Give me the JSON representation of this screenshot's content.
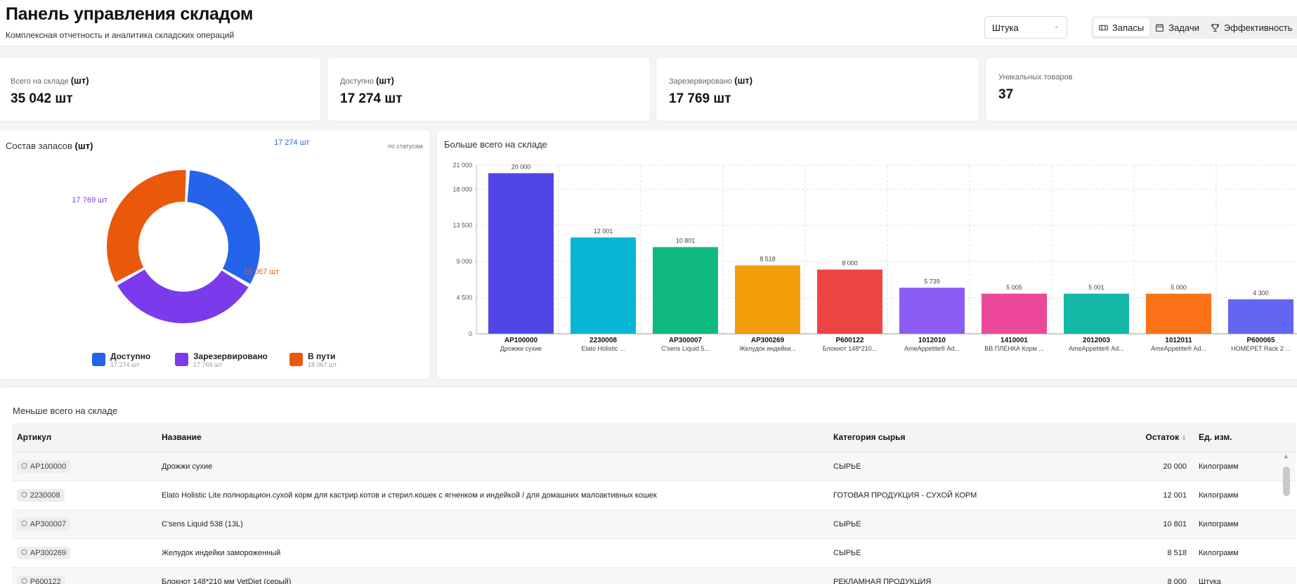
{
  "header": {
    "title": "Панель управления складом",
    "subtitle": "Комплексная отчетность и аналитика складских операций",
    "unit_select": "Штука",
    "tabs": [
      {
        "label": "Запасы",
        "icon": "boxes-icon",
        "active": true
      },
      {
        "label": "Задачи",
        "icon": "calendar-icon",
        "active": false
      },
      {
        "label": "Эффективность",
        "icon": "trophy-icon",
        "active": false
      }
    ]
  },
  "kpis": [
    {
      "label": "Всего на складе",
      "unit": "(шт)",
      "value": "35 042 шт"
    },
    {
      "label": "Доступно",
      "unit": "(шт)",
      "value": "17 274 шт"
    },
    {
      "label": "Зарезервировано",
      "unit": "(шт)",
      "value": "17 769 шт"
    },
    {
      "label": "Уникальных товаров",
      "unit": "",
      "value": "37"
    }
  ],
  "donut": {
    "title": "Состав запасов",
    "title_unit": "(шт)",
    "note": "по статусам",
    "segments": [
      {
        "name": "Доступно",
        "value": 17274,
        "label": "17 274 шт",
        "sub": "17 274 шт",
        "color": "#2563eb"
      },
      {
        "name": "Зарезервировано",
        "value": 17769,
        "label": "17 769 шт",
        "sub": "17 769 шт",
        "color": "#7c3aed"
      },
      {
        "name": "В пути",
        "value": 18067,
        "label": "18 067 шт",
        "sub": "18 067 шт",
        "color": "#ea580c"
      }
    ]
  },
  "bar": {
    "title": "Больше всего на складе"
  },
  "chart_data": {
    "type": "bar",
    "title": "Больше всего на складе",
    "ylim": [
      0,
      21000
    ],
    "yticks": [
      "0",
      "4 500",
      "9 000",
      "13 500",
      "18 000",
      "21 000"
    ],
    "ytick_values": [
      0,
      4500,
      9000,
      13500,
      18000,
      21000
    ],
    "grid": true,
    "categories": [
      "AP100000",
      "2230008",
      "AP300007",
      "AP300269",
      "P600122",
      "1012010",
      "1410001",
      "2012003",
      "1012011",
      "P600065"
    ],
    "subtitles": [
      "Дрожжи сухие",
      "Elato Holistic ...",
      "C'sens Liquid 5...",
      "Желудок индейки...",
      "Блокнот 148*210...",
      "AmeAppetite® Ad...",
      "BB ПЛЕНКА Корм ...",
      "AmeAppetite® Ad...",
      "AmeAppetite® Ad...",
      "HOMEPET Rack 2 ..."
    ],
    "values": [
      20000,
      12001,
      10801,
      8518,
      8000,
      5739,
      5005,
      5001,
      5000,
      4300
    ],
    "value_labels": [
      "20 000",
      "12 001",
      "10 801",
      "8 518",
      "8 000",
      "5 739",
      "5 005",
      "5 001",
      "5 000",
      "4 300"
    ],
    "colors": [
      "#4f46e5",
      "#06b6d4",
      "#10b981",
      "#f59e0b",
      "#ef4444",
      "#8b5cf6",
      "#ec4899",
      "#14b8a6",
      "#f97316",
      "#6366f1"
    ]
  },
  "table": {
    "title": "Меньше всего на складе",
    "columns": [
      "Артикул",
      "Название",
      "Категория сырья",
      "Остаток",
      "Ед. изм."
    ],
    "rows": [
      {
        "sku": "AP100000",
        "name": "Дрожжи сухие",
        "category": "СЫРЬЕ",
        "qty": "20 000",
        "unit": "Килограмм"
      },
      {
        "sku": "2230008",
        "name": "Elato Holistic Lite полнорацион.сухой корм для кастрир.котов и стерил.кошек с ягненком и индейкой / для домашних малоактивных кошек",
        "category": "ГОТОВАЯ ПРОДУКЦИЯ - СУХОЙ КОРМ",
        "qty": "12 001",
        "unit": "Килограмм"
      },
      {
        "sku": "AP300007",
        "name": "C'sens Liquid 538 (13L)",
        "category": "СЫРЬЕ",
        "qty": "10 801",
        "unit": "Килограмм"
      },
      {
        "sku": "AP300269",
        "name": "Желудок индейки замороженный",
        "category": "СЫРЬЕ",
        "qty": "8 518",
        "unit": "Килограмм"
      },
      {
        "sku": "P600122",
        "name": "Блокнот 148*210 мм VetDiet (серый)",
        "category": "РЕКЛАМНАЯ ПРОДУКЦИЯ",
        "qty": "8 000",
        "unit": "Штука"
      }
    ]
  }
}
